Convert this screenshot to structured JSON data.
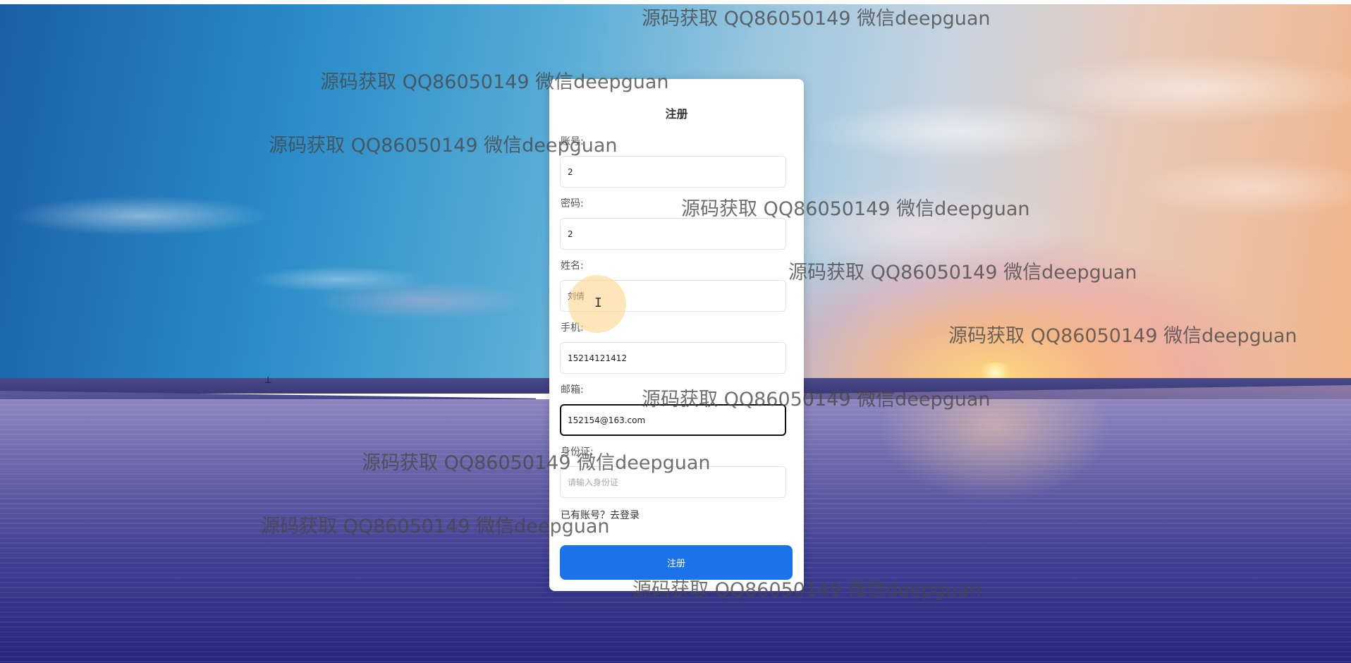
{
  "form": {
    "title": "注册",
    "fields": [
      {
        "label": "账号:",
        "value": "2",
        "placeholder": ""
      },
      {
        "label": "密码:",
        "value": "2",
        "placeholder": ""
      },
      {
        "label": "姓名:",
        "value": "刘倩",
        "placeholder": ""
      },
      {
        "label": "手机:",
        "value": "15214121412",
        "placeholder": ""
      },
      {
        "label": "邮箱:",
        "value": "152154@163.com",
        "placeholder": ""
      },
      {
        "label": "身份证:",
        "value": "",
        "placeholder": "请输入身份证"
      }
    ],
    "login_link": "已有账号？去登录",
    "submit_label": "注册"
  },
  "watermark_text": "源码获取 QQ86050149 微信deepguan",
  "icons": {
    "text_cursor": "I"
  },
  "colors": {
    "primary_button": "#1a73e8",
    "card_background": "#ffffff"
  }
}
